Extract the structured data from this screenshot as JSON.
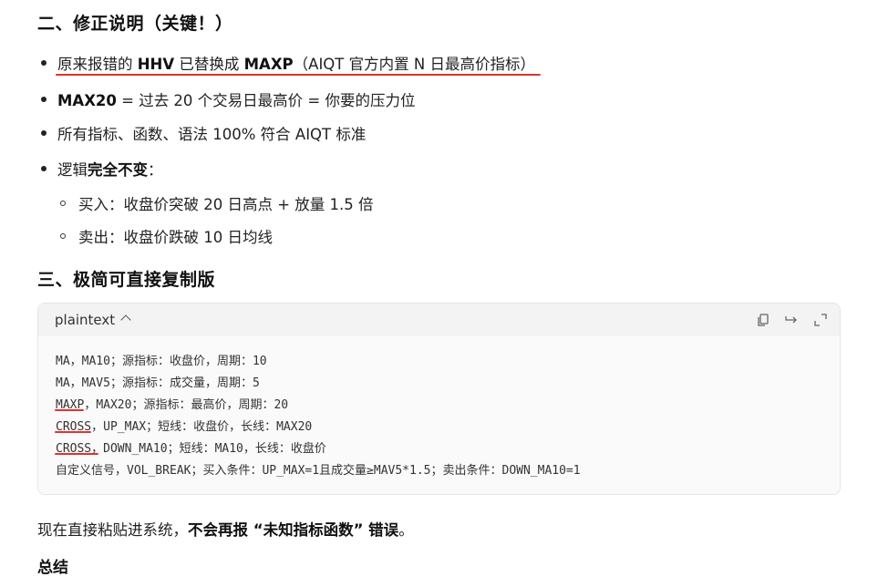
{
  "section2": {
    "title": "二、修正说明（关键！）",
    "bullets": [
      {
        "pre": "原来报错的 ",
        "b1": "HHV",
        "mid": " 已替换成 ",
        "b2": "MAXP",
        "post": "（AIQT 官方内置 N 日最高价指标）"
      },
      {
        "b1": "MAX20",
        "post": " = 过去 20 个交易日最高价 = 你要的压力位"
      },
      {
        "post": "所有指标、函数、语法 100% 符合 AIQT 标准"
      },
      {
        "pre": "逻辑",
        "b1": "完全不变",
        "post": "："
      }
    ],
    "subitems": [
      "买入：收盘价突破 20 日高点 + 放量 1.5 倍",
      "卖出：收盘价跌破 10 日均线"
    ]
  },
  "section3": {
    "title": "三、极简可直接复制版",
    "code": {
      "language": "plaintext",
      "icons": [
        "copy-icon",
        "wrap-icon",
        "expand-icon"
      ],
      "lines": [
        {
          "head": "",
          "rest": "MA，MA10；源指标：收盘价，周期：10"
        },
        {
          "head": "",
          "rest": "MA，MAV5；源指标：成交量，周期：5"
        },
        {
          "head": "MAXP",
          "rest": "，MAX20；源指标：最高价，周期：20"
        },
        {
          "head": "CROSS",
          "rest": "，UP_MAX；短线：收盘价，长线：MAX20"
        },
        {
          "head": "CROSS",
          "rest": "，DOWN_MA10；短线：MA10，长线：收盘价"
        },
        {
          "head": "",
          "rest": "自定义信号，VOL_BREAK；买入条件：UP_MAX=1且成交量≥MAV5*1.5；卖出条件：DOWN_MA10=1"
        }
      ]
    }
  },
  "closing": {
    "pre": "现在直接粘贴进系统，",
    "bold": "不会再报 “未知指标函数” 错误",
    "post": "。"
  },
  "summary_title": "总结",
  "colors": {
    "highlight_underline": "#e0332e"
  }
}
